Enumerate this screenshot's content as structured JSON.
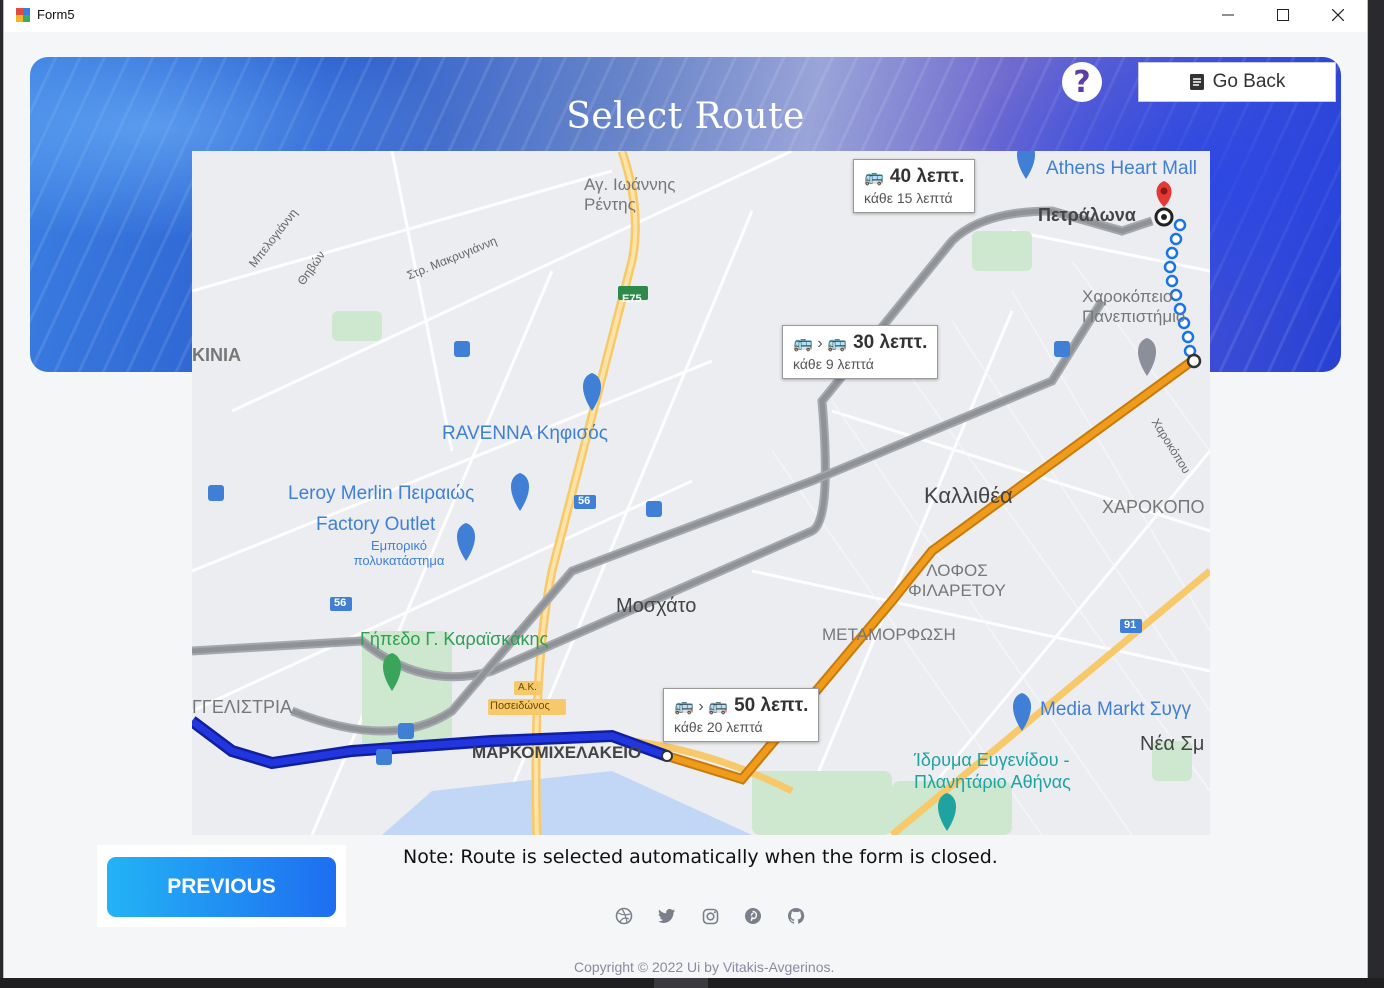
{
  "window": {
    "title": "Form5"
  },
  "header": {
    "title": "Select Route",
    "help_label": "?",
    "go_back_label": "Go Back"
  },
  "map": {
    "places": [
      "Αγ. Ιωάννης Ρέντης",
      "Petrálona",
      "Athens Heart Mall",
      "Χαροκόπειο Πανεπιστήμιο",
      "RAVENNA Κηφισός",
      "Leroy Merlin Πειραιώς",
      "Factory Outlet",
      "Εμπορικό πολυκατάστημα",
      "Καλλιθέα",
      "ΧΑΡΟΚΟΠΟ",
      "Μοσχάτο",
      "ΛΟΦΟΣ ΦΙΛΑΡΕΤΟΥ",
      "ΜΕΤΑΜΟΡΦΩΣΗ",
      "Γήπεδο Γ. Καραϊσκάκης",
      "ΓΓΕΛΙΣΤΡΙΑ",
      "ΜΑΡΚΟΜΙΧΕΛΑΚΕΙΟ",
      "Media Markt Συγγ",
      "Νέα Σμ",
      "Ίδρυμα Ευγενίδου - Πλανητάριο Αθήνας",
      "ΚΙΝΙΑ",
      "Στρ. Μακρυγιάννη",
      "Θηβών",
      "Μπελογιάννη",
      "Χαροκόπου",
      "Ποσειδώνος",
      "Α.Κ."
    ],
    "petralona": "Πετράλωνα",
    "road_shields": [
      "E75",
      "56",
      "56",
      "91"
    ],
    "routes": [
      {
        "time": "40 λεπτ.",
        "frequency": "κάθε 15 λεπτά"
      },
      {
        "time": "30 λεπτ.",
        "frequency": "κάθε 9 λεπτά"
      },
      {
        "time": "50 λεπτ.",
        "frequency": "κάθε 20 λεπτά"
      }
    ]
  },
  "note": "Note: Route is selected automatically when the form is closed.",
  "previous_label": "PREVIOUS",
  "socials": [
    "dribbble-icon",
    "twitter-icon",
    "instagram-icon",
    "pinterest-icon",
    "github-icon"
  ],
  "copyright": "Copyright © 2022 Ui by Vitakis-Avgerinos.",
  "colors": {
    "accent": "#1e6ef0",
    "route_selected": "#1a2fd6",
    "route_alt": "#f09b1a"
  }
}
